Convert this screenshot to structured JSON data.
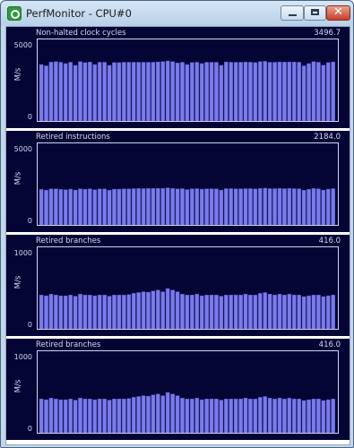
{
  "window": {
    "title": "PerfMonitor - CPU#0",
    "buttons": {
      "minimize": "minimize",
      "maximize": "maximize",
      "close": "✕"
    }
  },
  "colors": {
    "panel_bg": "#050535",
    "bar": "#7b7bea",
    "bar_edge": "#5050c8",
    "text": "#d6d8ee"
  },
  "panels": [
    {
      "label": "Non-halted clock cycles",
      "value": "3496.7",
      "unit": "M/s",
      "ymax_label": "5000",
      "ymin_label": "0"
    },
    {
      "label": "Retired instructions",
      "value": "2184.0",
      "unit": "M/s",
      "ymax_label": "5000",
      "ymin_label": "0"
    },
    {
      "label": "Retired branches",
      "value": "416.0",
      "unit": "M/s",
      "ymax_label": "1000",
      "ymin_label": "0"
    },
    {
      "label": "Retired branches",
      "value": "416.0",
      "unit": "M/s",
      "ymax_label": "1000",
      "ymin_label": "0"
    }
  ],
  "chart_data": [
    {
      "type": "bar",
      "title": "Non-halted clock cycles",
      "ylabel": "M/s",
      "ylim": [
        0,
        5000
      ],
      "values": [
        3500,
        3420,
        3650,
        3680,
        3640,
        3560,
        3640,
        3450,
        3680,
        3620,
        3650,
        3500,
        3640,
        3640,
        3450,
        3620,
        3620,
        3640,
        3640,
        3640,
        3640,
        3640,
        3640,
        3640,
        3660,
        3680,
        3720,
        3680,
        3600,
        3640,
        3500,
        3620,
        3640,
        3560,
        3640,
        3640,
        3640,
        3450,
        3660,
        3640,
        3640,
        3640,
        3650,
        3640,
        3620,
        3680,
        3700,
        3640,
        3640,
        3660,
        3650,
        3660,
        3650,
        3640,
        3420,
        3560,
        3680,
        3640,
        3460,
        3620,
        3660
      ]
    },
    {
      "type": "bar",
      "title": "Retired instructions",
      "ylabel": "M/s",
      "ylim": [
        0,
        5000
      ],
      "values": [
        2200,
        2150,
        2240,
        2240,
        2200,
        2180,
        2220,
        2160,
        2240,
        2210,
        2240,
        2180,
        2230,
        2230,
        2150,
        2220,
        2220,
        2230,
        2240,
        2250,
        2260,
        2250,
        2260,
        2260,
        2270,
        2270,
        2300,
        2270,
        2230,
        2250,
        2190,
        2240,
        2250,
        2220,
        2240,
        2240,
        2240,
        2160,
        2250,
        2250,
        2240,
        2240,
        2250,
        2250,
        2230,
        2260,
        2280,
        2250,
        2250,
        2260,
        2250,
        2260,
        2250,
        2240,
        2150,
        2210,
        2260,
        2240,
        2160,
        2220,
        2250
      ]
    },
    {
      "type": "bar",
      "title": "Retired branches",
      "ylabel": "M/s",
      "ylim": [
        0,
        1000
      ],
      "values": [
        420,
        410,
        430,
        420,
        410,
        410,
        420,
        405,
        430,
        420,
        420,
        410,
        420,
        420,
        405,
        420,
        420,
        420,
        425,
        440,
        450,
        460,
        455,
        470,
        480,
        460,
        500,
        480,
        460,
        430,
        420,
        420,
        430,
        410,
        420,
        420,
        420,
        405,
        420,
        420,
        420,
        420,
        430,
        420,
        420,
        440,
        450,
        430,
        420,
        430,
        420,
        430,
        420,
        420,
        400,
        410,
        420,
        420,
        400,
        410,
        420
      ]
    },
    {
      "type": "bar",
      "title": "Retired branches",
      "ylabel": "M/s",
      "ylim": [
        0,
        1000
      ],
      "values": [
        420,
        410,
        430,
        420,
        410,
        410,
        420,
        405,
        430,
        420,
        420,
        410,
        420,
        420,
        405,
        420,
        420,
        420,
        425,
        440,
        450,
        460,
        455,
        470,
        480,
        460,
        500,
        480,
        460,
        430,
        420,
        420,
        430,
        410,
        420,
        420,
        420,
        405,
        420,
        420,
        420,
        420,
        430,
        420,
        420,
        440,
        450,
        430,
        420,
        430,
        420,
        430,
        420,
        420,
        400,
        410,
        420,
        420,
        400,
        410,
        420
      ]
    }
  ]
}
